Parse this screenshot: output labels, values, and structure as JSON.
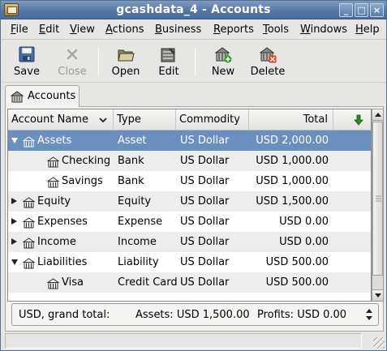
{
  "window": {
    "title": "gcashdata_4 - Accounts",
    "buttons": {
      "minimize": "_",
      "maximize": "□",
      "close": "×"
    }
  },
  "menubar": {
    "items": [
      {
        "accel": "F",
        "rest": "ile"
      },
      {
        "accel": "E",
        "rest": "dit"
      },
      {
        "accel": "V",
        "rest": "iew"
      },
      {
        "accel": "A",
        "rest": "ctions"
      },
      {
        "accel": "B",
        "rest": "usiness"
      },
      {
        "accel": "R",
        "rest": "eports"
      },
      {
        "accel": "T",
        "rest": "ools"
      },
      {
        "accel": "W",
        "rest": "indows"
      },
      {
        "accel": "H",
        "rest": "elp"
      }
    ]
  },
  "toolbar": {
    "save": "Save",
    "close": "Close",
    "open": "Open",
    "edit": "Edit",
    "new": "New",
    "delete": "Delete"
  },
  "tab": {
    "label": "Accounts",
    "icon": "account-house-icon"
  },
  "tree": {
    "columns": {
      "name": "Account Name",
      "type": "Type",
      "commodity": "Commodity",
      "total": "Total"
    },
    "rows": [
      {
        "name": "Assets",
        "type": "Asset",
        "commodity": "US Dollar",
        "total": "USD 2,000.00",
        "depth": 0,
        "expander": "open",
        "selected": true
      },
      {
        "name": "Checking",
        "type": "Bank",
        "commodity": "US Dollar",
        "total": "USD 1,000.00",
        "depth": 1,
        "expander": "none",
        "selected": false
      },
      {
        "name": "Savings",
        "type": "Bank",
        "commodity": "US Dollar",
        "total": "USD 1,000.00",
        "depth": 1,
        "expander": "none",
        "selected": false
      },
      {
        "name": "Equity",
        "type": "Equity",
        "commodity": "US Dollar",
        "total": "USD 1,500.00",
        "depth": 0,
        "expander": "closed",
        "selected": false
      },
      {
        "name": "Expenses",
        "type": "Expense",
        "commodity": "US Dollar",
        "total": "USD 0.00",
        "depth": 0,
        "expander": "closed",
        "selected": false
      },
      {
        "name": "Income",
        "type": "Income",
        "commodity": "US Dollar",
        "total": "USD 0.00",
        "depth": 0,
        "expander": "closed",
        "selected": false
      },
      {
        "name": "Liabilities",
        "type": "Liability",
        "commodity": "US Dollar",
        "total": "USD 500.00",
        "depth": 0,
        "expander": "open",
        "selected": false
      },
      {
        "name": "Visa",
        "type": "Credit Card",
        "commodity": "US Dollar",
        "total": "USD 500.00",
        "depth": 1,
        "expander": "none",
        "selected": false
      }
    ]
  },
  "summary": {
    "label": "USD, grand total:",
    "assets": "Assets: USD 1,500.00",
    "profits": "Profits: USD 0.00"
  },
  "colors": {
    "selection": "#6b8fbe",
    "titlebar": "#5577a5"
  }
}
